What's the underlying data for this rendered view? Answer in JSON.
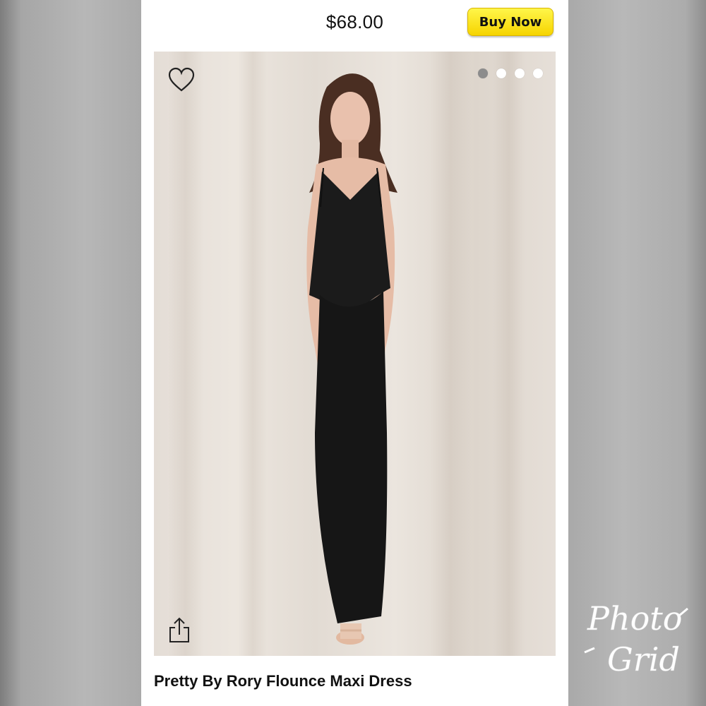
{
  "product": {
    "price": "$68.00",
    "buy_label": "Buy Now",
    "name": "Pretty By Rory Flounce Maxi Dress"
  },
  "image_carousel": {
    "total_images": 4,
    "active_index": 0
  },
  "icons": {
    "favorite": "heart-outline-icon",
    "share": "share-upload-icon"
  },
  "watermark": {
    "line1": "Photo",
    "line2": "Grid"
  },
  "colors": {
    "buy_button": "#f6d400",
    "background_frame": "#b0b0b0",
    "dot_active": "#8c8c8c",
    "dot_inactive": "#ffffff"
  }
}
